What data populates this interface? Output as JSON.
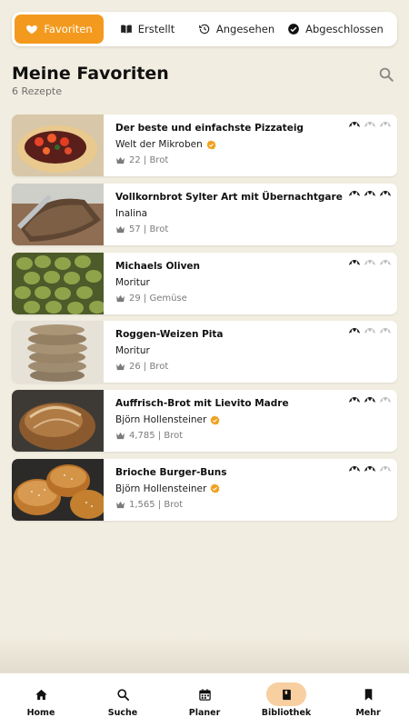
{
  "tabs": [
    {
      "label": "Favoriten",
      "icon": "heart-icon",
      "active": true
    },
    {
      "label": "Erstellt",
      "icon": "book-icon",
      "active": false
    },
    {
      "label": "Angesehen",
      "icon": "history-icon",
      "active": false
    },
    {
      "label": "Abgeschlossen",
      "icon": "check-circle-icon",
      "active": false
    }
  ],
  "header": {
    "title": "Meine Favoriten",
    "subtitle": "6 Rezepte"
  },
  "recipes": [
    {
      "title": "Der beste und einfachste Pizzateig",
      "author": "Welt der Mikroben",
      "verified": true,
      "meta": "22 | Brot",
      "difficulty": 1,
      "image": "pizza-image"
    },
    {
      "title": "Vollkornbrot Sylter Art mit Übernachtgare",
      "author": "Inalina",
      "verified": false,
      "meta": "57 | Brot",
      "difficulty": 3,
      "image": "rye-bread-image"
    },
    {
      "title": "Michaels Oliven",
      "author": "Moritur",
      "verified": false,
      "meta": "29 | Gemüse",
      "difficulty": 1,
      "image": "olives-jar-image"
    },
    {
      "title": "Roggen-Weizen Pita",
      "author": "Moritur",
      "verified": false,
      "meta": "26 | Brot",
      "difficulty": 1,
      "image": "pita-stack-image"
    },
    {
      "title": "Auffrisch-Brot mit Lievito Madre",
      "author": "Björn Hollensteiner",
      "verified": true,
      "meta": "4,785 | Brot",
      "difficulty": 2,
      "image": "sourdough-loaf-image"
    },
    {
      "title": "Brioche Burger-Buns",
      "author": "Björn Hollensteiner",
      "verified": true,
      "meta": "1,565 | Brot",
      "difficulty": 2,
      "image": "burger-buns-image"
    }
  ],
  "bottom_nav": [
    {
      "label": "Home",
      "icon": "home-icon",
      "active": false
    },
    {
      "label": "Suche",
      "icon": "search-icon",
      "active": false
    },
    {
      "label": "Planer",
      "icon": "calendar-icon",
      "active": false
    },
    {
      "label": "Bibliothek",
      "icon": "library-book-icon",
      "active": true
    },
    {
      "label": "Mehr",
      "icon": "bookmark-icon",
      "active": false
    }
  ],
  "colors": {
    "accent": "#f39a1e",
    "background": "#f1ede0",
    "verified": "#f0a020",
    "nav_active_bg": "#f8cfa0"
  }
}
